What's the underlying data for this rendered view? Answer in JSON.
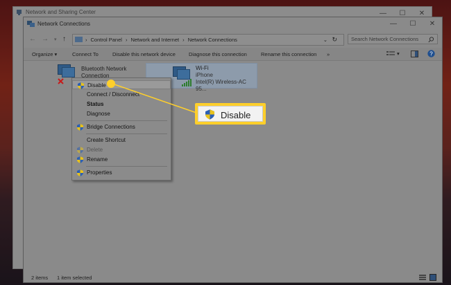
{
  "back_window": {
    "title": "Network and Sharing Center"
  },
  "window": {
    "title": "Network Connections",
    "caption": {
      "minimize": "—",
      "maximize": "☐",
      "close": "✕"
    }
  },
  "address": {
    "crumbs": [
      "Control Panel",
      "Network and Internet",
      "Network Connections"
    ],
    "search_placeholder": "Search Network Connections"
  },
  "commands": {
    "organize": "Organize",
    "connect_to": "Connect To",
    "disable_device": "Disable this network device",
    "diagnose": "Diagnose this connection",
    "rename": "Rename this connection",
    "more": "»"
  },
  "adapters": [
    {
      "name": "Bluetooth Network",
      "name2": "Connection"
    },
    {
      "name": "Wi-Fi",
      "network": "iPhone",
      "device": "Intel(R) Wireless-AC 95..."
    }
  ],
  "context_menu": {
    "items": [
      {
        "label": "Disable"
      },
      {
        "label": "Connect / Disconnect"
      },
      {
        "label": "Status"
      },
      {
        "label": "Diagnose"
      },
      {
        "label": "Bridge Connections"
      },
      {
        "label": "Create Shortcut"
      },
      {
        "label": "Delete"
      },
      {
        "label": "Rename"
      },
      {
        "label": "Properties"
      }
    ]
  },
  "callout": {
    "label": "Disable",
    "color": "#ffcf2b"
  },
  "status": {
    "items": "2 items",
    "selected": "1 item selected"
  }
}
